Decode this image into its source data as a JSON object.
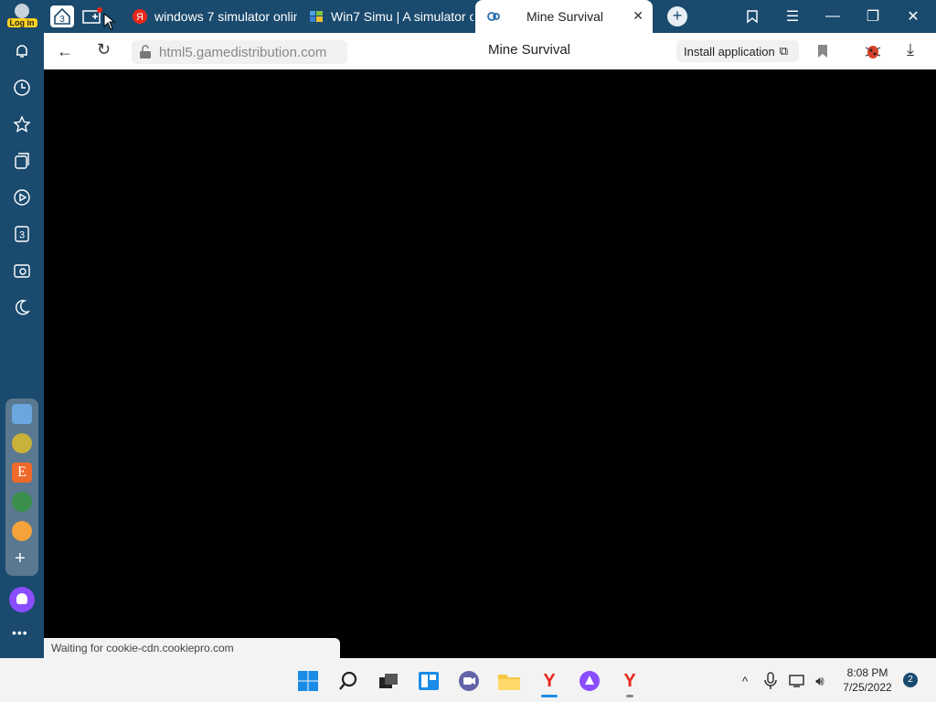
{
  "login": {
    "label": "Log in"
  },
  "tabs": [
    {
      "title": "windows 7 simulator onlin",
      "favicon": "yandex-icon"
    },
    {
      "title": "Win7 Simu | A simulator o",
      "favicon": "windows-flag-icon"
    },
    {
      "title": "Mine Survival",
      "favicon": "gamedistribution-icon",
      "active": true
    }
  ],
  "tab_counter": "3",
  "address": {
    "url": "html5.gamedistribution.com",
    "page_title": "Mine Survival",
    "install_label": "Install application"
  },
  "sidebar": {
    "items": [
      "bell-icon",
      "history-icon",
      "star-icon",
      "collections-icon",
      "video-icon",
      "tabs-counter-icon",
      "screenshot-icon",
      "moon-icon"
    ],
    "tabs_count": "3"
  },
  "status_text": "Waiting for cookie-cdn.cookiepro.com",
  "taskbar": {
    "time": "8:08 PM",
    "date": "7/25/2022",
    "notifications": "2"
  },
  "colors": {
    "frame": "#1a4a6e",
    "accent_yellow": "#ffd21f",
    "yandex_red": "#e8271a",
    "alice_purple": "#8a4dff"
  }
}
